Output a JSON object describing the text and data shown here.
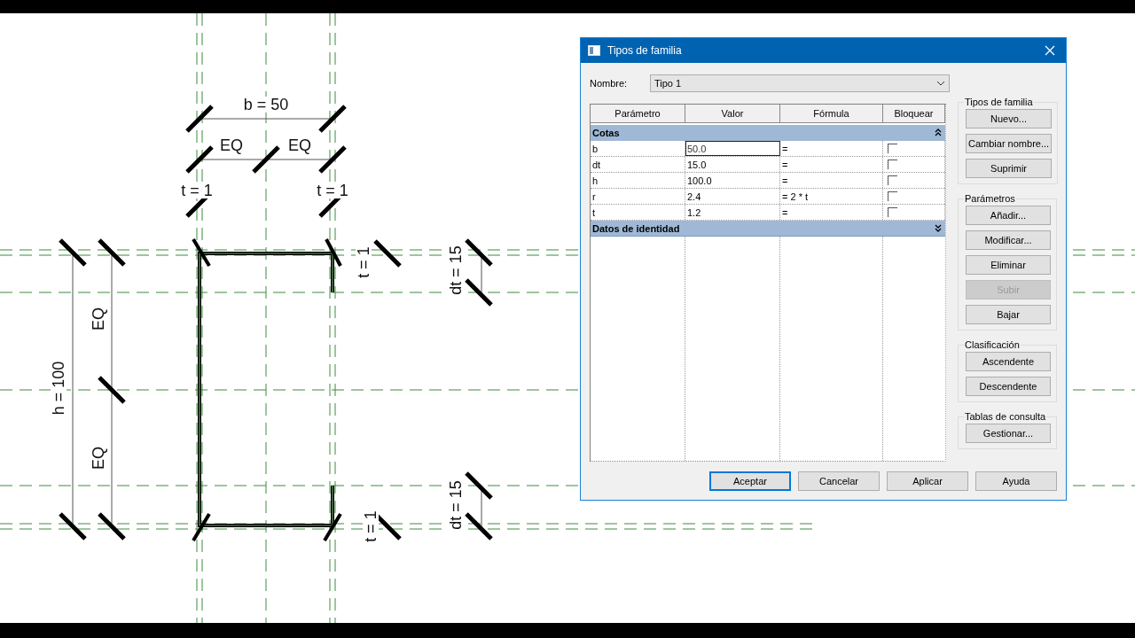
{
  "drawing": {
    "labels": [
      {
        "text": "b = 50",
        "kind": "horizontal"
      },
      {
        "text": "EQ",
        "kind": "horizontal"
      },
      {
        "text": "EQ",
        "kind": "horizontal"
      },
      {
        "text": "t = 1",
        "kind": "horizontal"
      },
      {
        "text": "t = 1",
        "kind": "horizontal"
      },
      {
        "text": "h = 100",
        "kind": "vertical"
      },
      {
        "text": "EQ",
        "kind": "vertical"
      },
      {
        "text": "EQ",
        "kind": "vertical"
      },
      {
        "text": "t = 1",
        "kind": "vertical"
      },
      {
        "text": "dt = 15",
        "kind": "vertical"
      },
      {
        "text": "dt = 15",
        "kind": "vertical"
      },
      {
        "text": "t = 1",
        "kind": "vertical"
      }
    ]
  },
  "dialog": {
    "title": "Tipos de familia",
    "name_label": "Nombre:",
    "name_value": "Tipo 1",
    "table": {
      "columns": [
        "Parámetro",
        "Valor",
        "Fórmula",
        "Bloquear"
      ],
      "groups": [
        {
          "title": "Cotas",
          "expanded": true,
          "rows": [
            {
              "parameter": "b",
              "value": "50.0",
              "formula": "=",
              "locked": false,
              "selected": true
            },
            {
              "parameter": "dt",
              "value": "15.0",
              "formula": "=",
              "locked": false,
              "selected": false
            },
            {
              "parameter": "h",
              "value": "100.0",
              "formula": "=",
              "locked": false,
              "selected": false
            },
            {
              "parameter": "r",
              "value": "2.4",
              "formula": "= 2 * t",
              "locked": false,
              "selected": false
            },
            {
              "parameter": "t",
              "value": "1.2",
              "formula": "=",
              "locked": false,
              "selected": false
            }
          ]
        },
        {
          "title": "Datos de identidad",
          "expanded": false
        }
      ]
    },
    "side_groups": [
      {
        "title": "Tipos de familia",
        "buttons": [
          {
            "label": "Nuevo...",
            "disabled": false
          },
          {
            "label": "Cambiar nombre...",
            "disabled": false
          },
          {
            "label": "Suprimir",
            "disabled": false
          }
        ]
      },
      {
        "title": "Parámetros",
        "buttons": [
          {
            "label": "Añadir...",
            "disabled": false
          },
          {
            "label": "Modificar...",
            "disabled": false
          },
          {
            "label": "Eliminar",
            "disabled": false
          },
          {
            "label": "Subir",
            "disabled": true
          },
          {
            "label": "Bajar",
            "disabled": false
          }
        ]
      },
      {
        "title": "Clasificación",
        "buttons": [
          {
            "label": "Ascendente",
            "disabled": false
          },
          {
            "label": "Descendente",
            "disabled": false
          }
        ]
      },
      {
        "title": "Tablas de consulta",
        "buttons": [
          {
            "label": "Gestionar...",
            "disabled": false
          }
        ]
      }
    ],
    "footer_buttons": [
      {
        "label": "Aceptar",
        "default": true
      },
      {
        "label": "Cancelar",
        "default": false
      },
      {
        "label": "Aplicar",
        "default": false
      },
      {
        "label": "Ayuda",
        "default": false
      }
    ]
  }
}
